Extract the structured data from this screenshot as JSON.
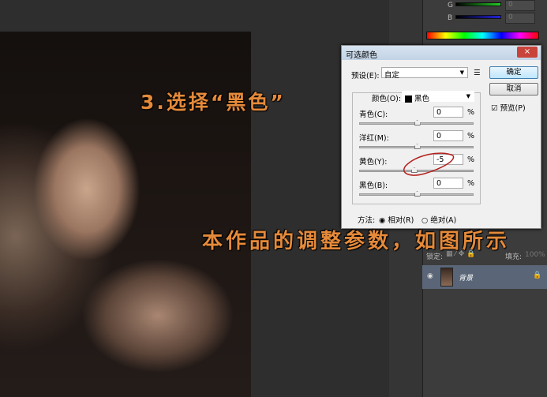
{
  "color_panel": {
    "g_label": "G",
    "b_label": "B",
    "g_value": "0",
    "b_value": "0"
  },
  "dialog": {
    "title": "可选颜色",
    "close": "×",
    "preset_label": "预设(E):",
    "preset_value": "自定",
    "ok": "确定",
    "cancel": "取消",
    "preview_label": "预览(P)",
    "preview_checked": true,
    "colors_label": "颜色(O):",
    "colors_value": "黑色",
    "sliders": [
      {
        "label": "青色(C):",
        "value": "0",
        "pct": "%",
        "position": 0.5
      },
      {
        "label": "洋红(M):",
        "value": "0",
        "pct": "%",
        "position": 0.5
      },
      {
        "label": "黄色(Y):",
        "value": "-5",
        "pct": "%",
        "position": 0.475
      },
      {
        "label": "黑色(B):",
        "value": "0",
        "pct": "%",
        "position": 0.5
      }
    ],
    "method_label": "方法:",
    "method_relative": "相对(R)",
    "method_absolute": "绝对(A)"
  },
  "layers": {
    "lock_label": "锁定:",
    "fill_label": "填充:",
    "fill_value": "100%",
    "layer_name": "背景"
  },
  "overlay": {
    "step": "3.选择“黑色”",
    "caption": "本作品的调整参数，如图所示"
  }
}
